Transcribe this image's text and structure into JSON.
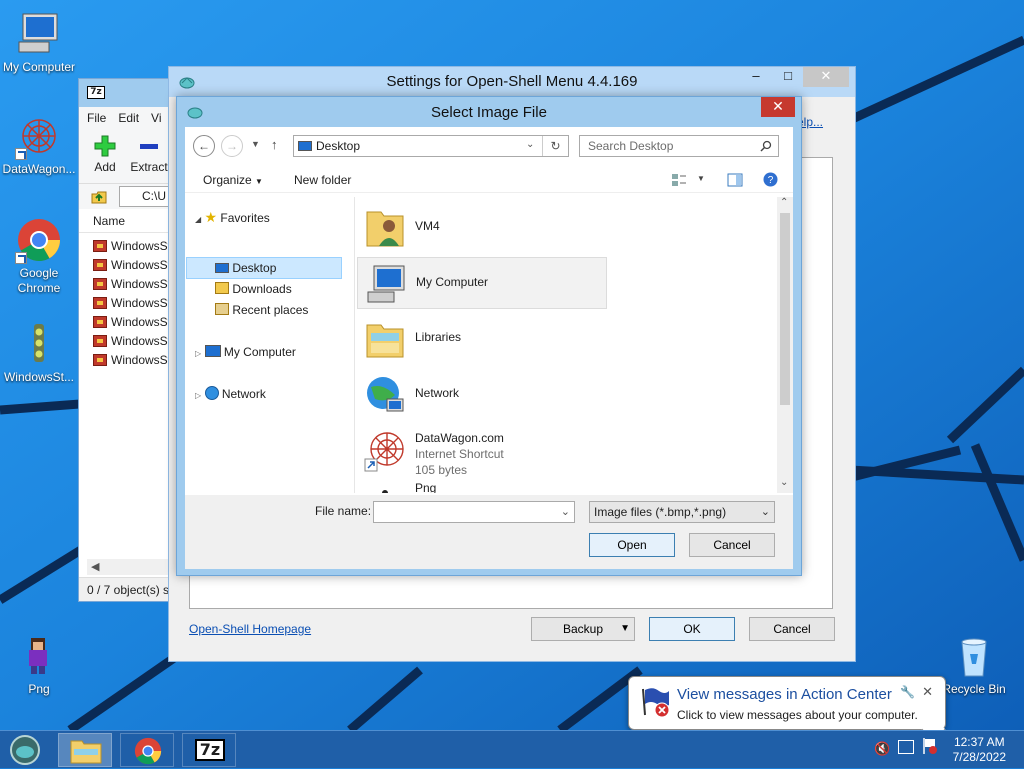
{
  "desktop": {
    "icons": [
      {
        "label": "My Computer"
      },
      {
        "label": "DataWagon..."
      },
      {
        "label": "Google Chrome"
      },
      {
        "label": "WindowsSt..."
      },
      {
        "label": "Png"
      },
      {
        "label": "Recycle Bin"
      }
    ]
  },
  "zip": {
    "menu": [
      "File",
      "Edit",
      "Vi"
    ],
    "tools": {
      "add": "Add",
      "extract": "Extract"
    },
    "address": "C:\\U",
    "column_name": "Name",
    "files": [
      "WindowsSt",
      "WindowsSt",
      "WindowsSt",
      "WindowsSt",
      "WindowsSt",
      "WindowsSt",
      "WindowsSt"
    ],
    "status": "0 / 7 object(s) s"
  },
  "settings": {
    "title": "Settings for Open-Shell Menu 4.4.169",
    "help_link": "elp...",
    "homepage_link": "Open-Shell Homepage",
    "backup_label": "Backup",
    "ok_label": "OK",
    "cancel_label": "Cancel",
    "window_controls": {
      "minimize": "–",
      "maximize": "□",
      "close": "✕"
    }
  },
  "dialog": {
    "title": "Select Image File",
    "close": "✕",
    "address": "Desktop",
    "search_placeholder": "Search Desktop",
    "organize": "Organize",
    "new_folder": "New folder",
    "nav": {
      "favorites": "Favorites",
      "desktop": "Desktop",
      "downloads": "Downloads",
      "recent": "Recent places",
      "my_computer": "My Computer",
      "network": "Network"
    },
    "files": [
      {
        "name": "VM4",
        "icon": "user-folder-icon"
      },
      {
        "name": "My Computer",
        "icon": "computer-icon"
      },
      {
        "name": "Libraries",
        "icon": "libraries-icon"
      },
      {
        "name": "Network",
        "icon": "network-icon"
      },
      {
        "name": "DataWagon.com",
        "type": "Internet Shortcut",
        "size": "105 bytes",
        "icon": "internet-shortcut-icon"
      },
      {
        "name": "Png",
        "icon": "png-icon"
      }
    ],
    "file_name_label": "File name:",
    "file_name_value": "",
    "file_type": "Image files (*.bmp,*.png)",
    "open_label": "Open",
    "cancel_label": "Cancel"
  },
  "notification": {
    "title": "View messages in Action Center",
    "message": "Click to view messages about your computer.",
    "close": "✕"
  },
  "taskbar": {
    "time": "12:37 AM",
    "date": "7/28/2022",
    "zip_label": "7z"
  },
  "colors": {
    "wallpaper": "#1a7fd8",
    "dialog_frame": "#9fcbee",
    "selection": "#cce8ff",
    "close_red": "#c6392f",
    "link": "#0b4fb3"
  }
}
